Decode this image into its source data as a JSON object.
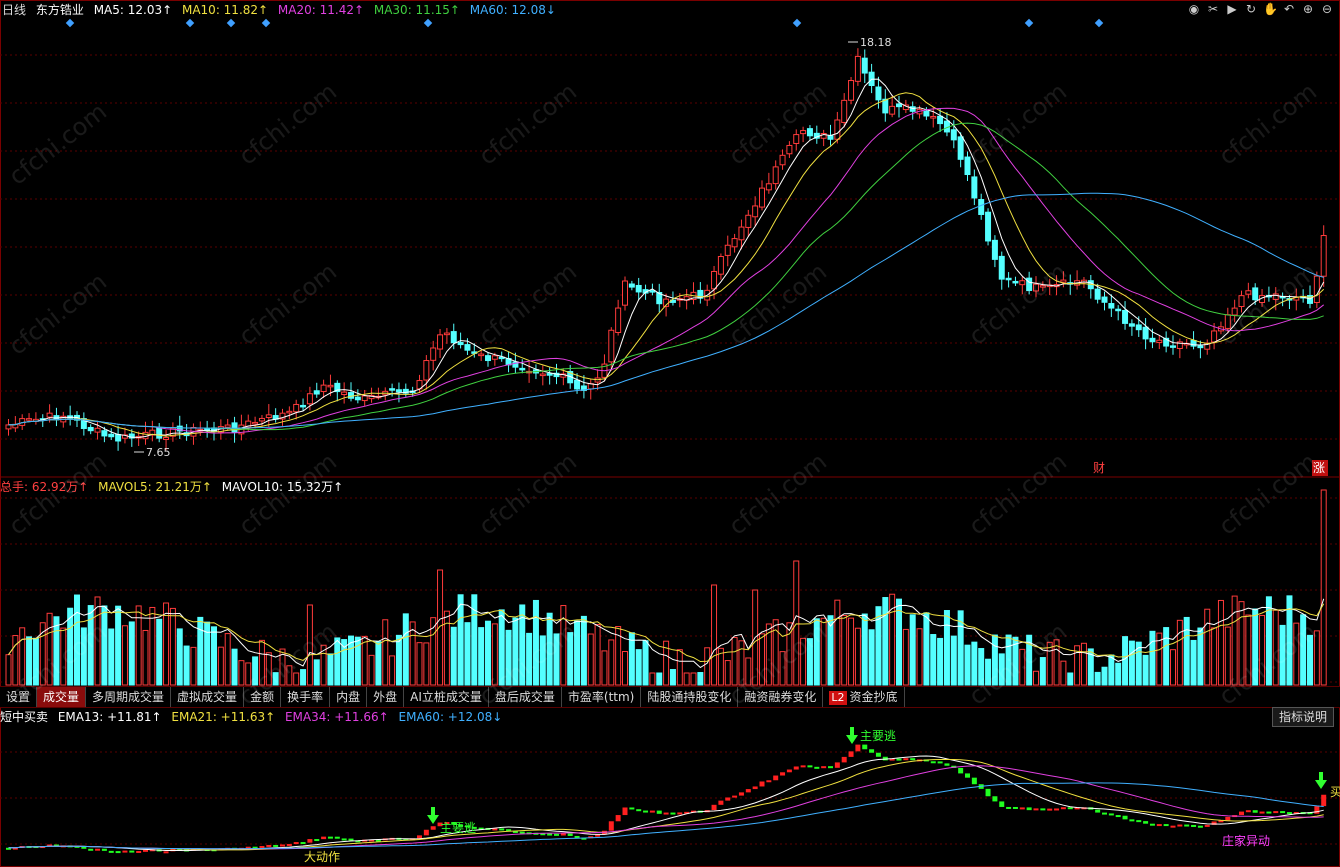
{
  "header": {
    "period": "日线",
    "stock_name": "东方锆业",
    "ma": [
      {
        "label": "MA5: 12.03↑",
        "color": "#ffffff"
      },
      {
        "label": "MA10: 11.82↑",
        "color": "#f0e040"
      },
      {
        "label": "MA20: 11.42↑",
        "color": "#e040e0"
      },
      {
        "label": "MA30: 11.15↑",
        "color": "#40d040"
      },
      {
        "label": "MA60: 12.08↓",
        "color": "#40b0ff"
      }
    ]
  },
  "price_chart": {
    "high_label": "18.18",
    "low_label": "7.65",
    "markers": [
      "财",
      "涨"
    ]
  },
  "volume_header": {
    "total": "总手: 62.92万↑",
    "mavol5": "MAVOL5: 21.21万↑",
    "mavol10": "MAVOL10: 15.32万↑"
  },
  "tabs": [
    "设置",
    "成交量",
    "多周期成交量",
    "虚拟成交量",
    "金额",
    "换手率",
    "内盘",
    "外盘",
    "AI立桩成交量",
    "盘后成交量",
    "市盈率(ttm)",
    "陆股通持股变化",
    "融资融券变化",
    "资金抄底"
  ],
  "tab_active": "成交量",
  "l2_badge": "L2",
  "indicator_header": {
    "name": "短中买卖",
    "ema13": "EMA13: +11.81↑",
    "ema21": "EMA21: +11.63↑",
    "ema34": "EMA34: +11.66↑",
    "ema60": "EMA60: +12.08↓"
  },
  "indicator_button": "指标说明",
  "indicator_labels": [
    "主要逃",
    "主要逃",
    "大动作",
    "庄家异动",
    "买"
  ],
  "watermark": "cfchi.com",
  "colors": {
    "up": "#ff3b3b",
    "down": "#54ffff",
    "ind_up": "#ff2020",
    "ind_down": "#20ff20"
  }
}
